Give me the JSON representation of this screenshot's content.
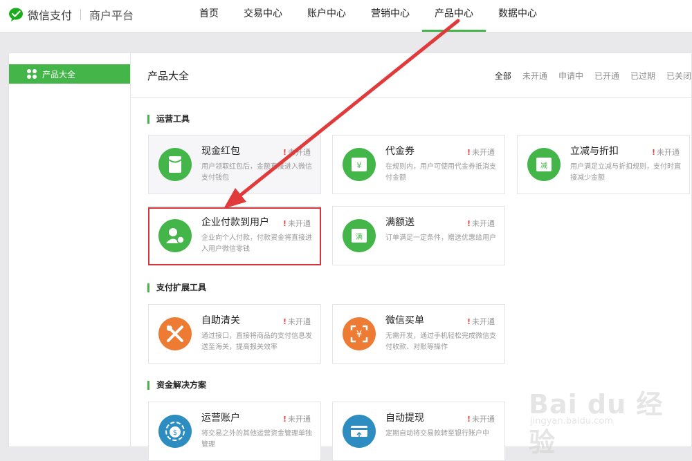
{
  "header": {
    "brand": "微信支付",
    "subtitle": "商户平台",
    "nav": [
      {
        "label": "首页"
      },
      {
        "label": "交易中心"
      },
      {
        "label": "账户中心"
      },
      {
        "label": "营销中心"
      },
      {
        "label": "产品中心",
        "active": true
      },
      {
        "label": "数据中心"
      }
    ]
  },
  "sidebar": {
    "items": [
      {
        "label": "产品大全",
        "icon": "grid-icon",
        "active": true
      }
    ]
  },
  "content": {
    "title": "产品大全",
    "filters": [
      {
        "label": "全部",
        "active": true
      },
      {
        "label": "未开通"
      },
      {
        "label": "申请中"
      },
      {
        "label": "已开通"
      },
      {
        "label": "已过期"
      },
      {
        "label": "已关闭"
      }
    ]
  },
  "sections": [
    {
      "title": "运营工具",
      "cards": [
        {
          "name": "现金红包",
          "status": "未开通",
          "desc": "用户领取红包后，金额直接进入微信支付钱包",
          "icon": "red-packet-icon",
          "color": "#44b549"
        },
        {
          "name": "代金券",
          "status": "未开通",
          "desc": "在规则内，用户可使用代金券抵消支付金额",
          "icon": "voucher-icon",
          "color": "#44b549"
        },
        {
          "name": "立减与折扣",
          "status": "未开通",
          "desc": "用户满足立减与折扣规则，支付时直接减少金额",
          "icon": "discount-icon",
          "color": "#44b549"
        },
        {
          "name": "企业付款到用户",
          "status": "未开通",
          "desc": "企业向个人付款，付款资金将直接进入用户微信零钱",
          "icon": "enterprise-pay-icon",
          "color": "#44b549"
        },
        {
          "name": "满额送",
          "status": "未开通",
          "desc": "订单满足一定条件，赠送优惠给用户",
          "icon": "full-gift-icon",
          "color": "#44b549"
        }
      ]
    },
    {
      "title": "支付扩展工具",
      "cards": [
        {
          "name": "自助清关",
          "status": "未开通",
          "desc": "通过接口，直接将商品的支付信息发送至海关，提高报关效率",
          "icon": "tools-icon",
          "color": "#ee7b34"
        },
        {
          "name": "微信买单",
          "status": "未开通",
          "desc": "无需开发，通过手机轻松完成微信支付收款、对账等操作",
          "icon": "scan-pay-icon",
          "color": "#ee7b34"
        }
      ]
    },
    {
      "title": "资金解决方案",
      "cards": [
        {
          "name": "运营账户",
          "status": "未开通",
          "desc": "将交易之外的其他运营资金管理单独管理",
          "icon": "money-bag-icon",
          "color": "#2d8cc0"
        },
        {
          "name": "自动提现",
          "status": "未开通",
          "desc": "定期自动将交易款转至银行账户中",
          "icon": "bank-card-icon",
          "color": "#2d8cc0"
        }
      ]
    }
  ],
  "watermark": {
    "main": "Bai du 经验",
    "sub": "jingyan.baidu.com"
  }
}
